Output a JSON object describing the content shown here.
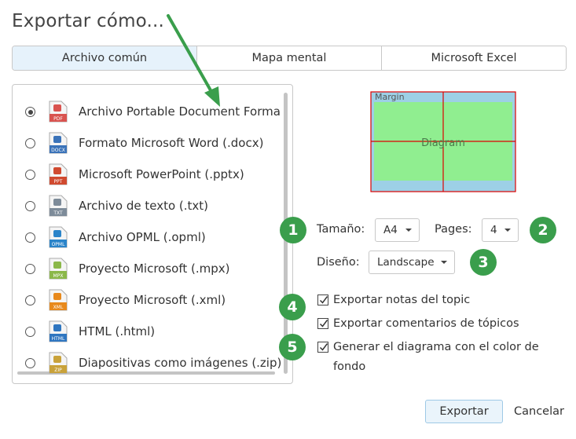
{
  "dialog": {
    "title": "Exportar cómo..."
  },
  "tabs": [
    {
      "label": "Archivo común",
      "active": true
    },
    {
      "label": "Mapa mental",
      "active": false
    },
    {
      "label": "Microsoft Excel",
      "active": false
    }
  ],
  "formats": [
    {
      "label": "Archivo Portable Document Forma",
      "icon_tag": "PDF",
      "icon_color": "#d9534f",
      "selected": true
    },
    {
      "label": "Formato Microsoft Word (.docx)",
      "icon_tag": "DOCX",
      "icon_color": "#3b73b9",
      "selected": false
    },
    {
      "label": "Microsoft PowerPoint (.pptx)",
      "icon_tag": "PPT",
      "icon_color": "#d04a30",
      "selected": false
    },
    {
      "label": "Archivo de texto (.txt)",
      "icon_tag": "TXT",
      "icon_color": "#7d8b99",
      "selected": false
    },
    {
      "label": "Archivo OPML (.opml)",
      "icon_tag": "OPML",
      "icon_color": "#2b84c9",
      "selected": false
    },
    {
      "label": "Proyecto Microsoft (.mpx)",
      "icon_tag": "MPX",
      "icon_color": "#8bb84a",
      "selected": false
    },
    {
      "label": "Proyecto Microsoft (.xml)",
      "icon_tag": "XML",
      "icon_color": "#e8891c",
      "selected": false
    },
    {
      "label": "HTML (.html)",
      "icon_tag": "HTML",
      "icon_color": "#2f76c0",
      "selected": false
    },
    {
      "label": "Diapositivas como imágenes (.zip)",
      "icon_tag": "ZIP",
      "icon_color": "#c9a23a",
      "selected": false
    }
  ],
  "preview": {
    "margin_label": "Margin",
    "diagram_label": "Diagram",
    "page_color": "#9dd0e6",
    "diagram_color": "#90ee90",
    "grid_color": "#dd0000"
  },
  "settings": {
    "size_label": "Tamaño:",
    "size_value": "A4",
    "pages_label": "Pages:",
    "pages_value": "4",
    "design_label": "Diseño:",
    "design_value": "Landscape"
  },
  "options": [
    {
      "label": "Exportar notas del topic",
      "checked": true
    },
    {
      "label": "Exportar comentarios de tópicos",
      "checked": true
    },
    {
      "label": "Generar el diagrama con el color de",
      "label2": "fondo",
      "checked": true
    }
  ],
  "callouts": [
    "1",
    "2",
    "3",
    "4",
    "5"
  ],
  "accent_color": "#3a9e4c",
  "buttons": {
    "export": "Exportar",
    "cancel": "Cancelar"
  }
}
